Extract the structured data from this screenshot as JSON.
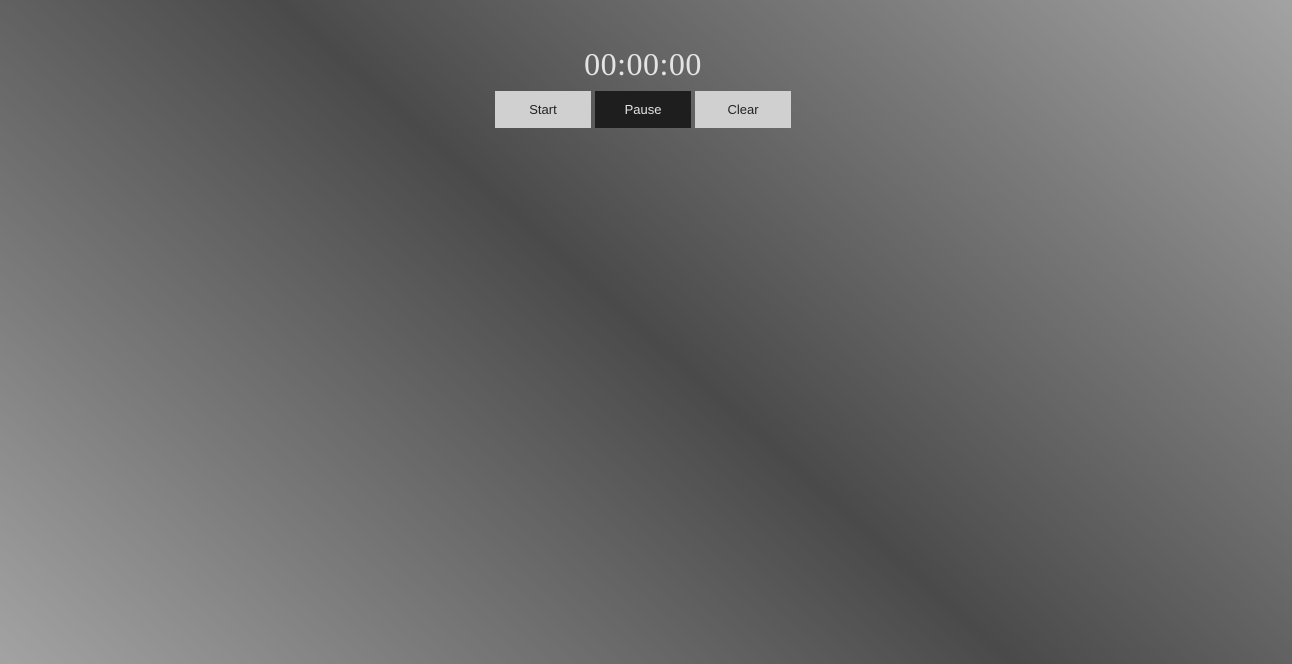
{
  "stopwatch": {
    "time": "00:00:00",
    "buttons": {
      "start": "Start",
      "pause": "Pause",
      "clear": "Clear"
    }
  },
  "colors": {
    "background_light": "#a3a3a3",
    "background_dark": "#4a4a4a",
    "time_text": "#e4e4e4",
    "button_light": "#d0d0d0",
    "button_dark": "#1e1e1e"
  }
}
